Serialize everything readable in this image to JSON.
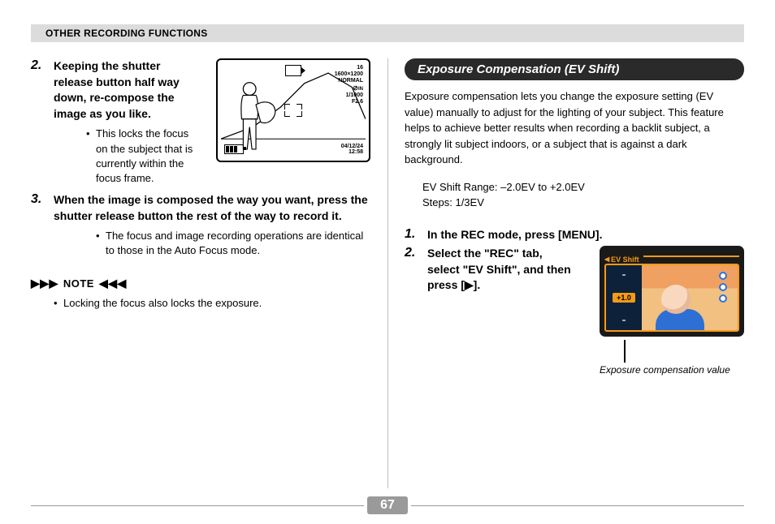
{
  "header": "OTHER RECORDING FUNCTIONS",
  "left": {
    "step2_num": "2.",
    "step2_text": "Keeping the shutter release button half way down, re-compose the image as you like.",
    "step2_bullet": "This locks the focus on the subject that is currently within the focus frame.",
    "step3_num": "3.",
    "step3_text": "When the image is composed the way you want, press the shutter release button the rest of the way to record it.",
    "step3_bullet": "The focus and image recording operations are identical to those in the Auto Focus mode.",
    "note_label": "NOTE",
    "note_bullet": "Locking the focus also locks the exposure."
  },
  "right": {
    "section_title": "Exposure Compensation (EV Shift)",
    "intro": "Exposure compensation lets you change the exposure setting (EV value) manually to adjust for the lighting of your subject. This feature helps to achieve better results when recording a backlit subject, a strongly lit subject indoors, or a subject that is against a dark background.",
    "spec_line1": "EV Shift Range: –2.0EV to +2.0EV",
    "spec_line2": "Steps: 1/3EV",
    "step1_num": "1.",
    "step1_text": "In the REC mode, press [MENU].",
    "step2_num": "2.",
    "step2_text": "Select the \"REC\" tab, select \"EV Shift\", and then press [▶].",
    "ev_menu_label": "EV Shift",
    "ev_value": "+1.0",
    "ev_caption": "Exposure compensation value"
  },
  "lcd": {
    "shots": "16",
    "res": "1600×1200",
    "quality": "NORMAL",
    "flash_icon": "flash-off",
    "shutter": "1/1000",
    "aperture": "F2.6",
    "date": "04/12/24",
    "time": "12:58"
  },
  "page_number": "67"
}
